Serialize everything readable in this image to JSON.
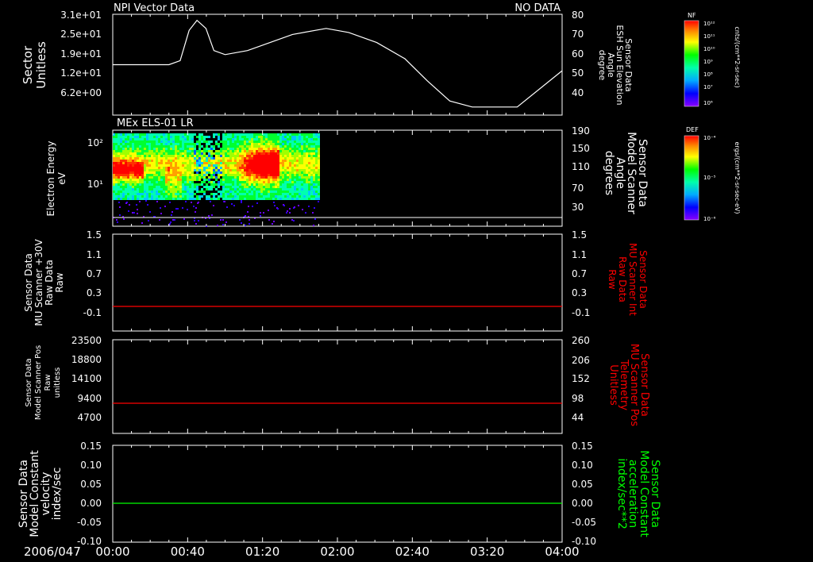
{
  "panel1": {
    "title": "NPI Vector Data",
    "status": "NO DATA",
    "left_label": [
      "Sector",
      "Unitless"
    ],
    "right_label": [
      "Sensor Data",
      "ESH Sun Elevation",
      "Angle",
      "degree"
    ],
    "left_ticks": [
      "3.1e+01",
      "2.5e+01",
      "1.9e+01",
      "1.2e+01",
      "6.2e+00"
    ],
    "right_ticks": [
      "80",
      "70",
      "60",
      "50",
      "40"
    ]
  },
  "panel2": {
    "title": "MEx ELS-01 LR",
    "left_label": [
      "Electron Energy",
      "eV"
    ],
    "right_label": [
      "Sensor Data",
      "Model Scanner",
      "Angle",
      "degrees"
    ],
    "left_ticks": [
      "10²",
      "10¹"
    ],
    "right_ticks": [
      "190",
      "150",
      "110",
      "70",
      "30"
    ]
  },
  "panel3": {
    "left_label": [
      "Sensor Data",
      "MU Scanner +30V",
      "Raw Data",
      "Raw"
    ],
    "right_label": [
      "Sensor Data",
      "MU Scanner Int",
      "Raw Data",
      "Raw"
    ],
    "left_ticks": [
      "1.5",
      "1.1",
      "0.7",
      "0.3",
      "-0.1"
    ],
    "right_ticks": [
      "1.5",
      "1.1",
      "0.7",
      "0.3",
      "-0.1"
    ]
  },
  "panel4": {
    "left_label": [
      "Sensor Data",
      "Model Scanner Pos",
      "Raw",
      "unitless"
    ],
    "right_label": [
      "Sensor Data",
      "MU Scanner Pos",
      "Telemetry",
      "Unitless"
    ],
    "left_ticks": [
      "23500",
      "18800",
      "14100",
      "9400",
      "4700"
    ],
    "right_ticks": [
      "260",
      "206",
      "152",
      "98",
      "44"
    ]
  },
  "panel5": {
    "left_label": [
      "Sensor Data",
      "Model Constant",
      "velocity",
      "index/sec"
    ],
    "right_label": [
      "Sensor Data",
      "Model Constant",
      "acceleration",
      "index/sec**2"
    ],
    "left_ticks": [
      "0.15",
      "0.10",
      "0.05",
      "0.00",
      "-0.05",
      "-0.10"
    ],
    "right_ticks": [
      "0.15",
      "0.10",
      "0.05",
      "0.00",
      "-0.05",
      "-0.10"
    ]
  },
  "time_axis": {
    "date": "2006/047",
    "ticks": [
      "00:00",
      "00:40",
      "01:20",
      "02:00",
      "02:40",
      "03:20",
      "04:00"
    ]
  },
  "colorbar1": {
    "title": "NF",
    "units": "cnts/(cm**2-sr-sec)",
    "ticks": [
      "10¹²",
      "10¹¹",
      "10¹⁰",
      "10⁹",
      "10⁸",
      "10⁷",
      "10⁶"
    ]
  },
  "colorbar2": {
    "title": "DEF",
    "units": "ergs/(cm**2-sr-sec-eV)",
    "ticks": [
      "10⁻⁴",
      "10⁻⁵",
      "10⁻⁶"
    ]
  },
  "colors": {
    "trace_white": "#ffffff",
    "trace_red": "#ff0000",
    "trace_green": "#00ff00",
    "label_red": "#ff0000",
    "label_green": "#00ff00"
  },
  "chart_data": [
    {
      "type": "line",
      "panel": "panel1",
      "x_unit": "hours since 00:00",
      "x": [
        0,
        0.5,
        0.6,
        0.68,
        0.75,
        0.83,
        0.9,
        1.0,
        1.2,
        1.4,
        1.6,
        1.9,
        2.1,
        2.35,
        2.6,
        2.8,
        3.0,
        3.2,
        3.4,
        3.6,
        4.0
      ],
      "y_unit": "degree",
      "y": [
        55,
        55,
        57,
        72,
        77,
        73,
        62,
        60,
        62,
        66,
        70,
        73,
        71,
        66,
        58,
        47,
        37,
        34,
        34,
        34,
        52
      ],
      "ylim": [
        30,
        80
      ]
    },
    {
      "type": "heatmap",
      "panel": "panel2",
      "x_range_hours": [
        0,
        1.8
      ],
      "y_label": "Electron Energy eV",
      "description_features": "intense flux at ~10-100 eV early and near 01:05-01:20"
    },
    {
      "type": "line",
      "panel": "panel3",
      "series": [
        {
          "values_constant": -0.05
        }
      ],
      "ylim": [
        -0.3,
        1.5
      ]
    },
    {
      "type": "line",
      "panel": "panel4",
      "series": [
        {
          "values_constant": 7500
        }
      ],
      "ylim": [
        0,
        23500
      ]
    },
    {
      "type": "line",
      "panel": "panel5",
      "series": [
        {
          "values_constant": 0.0
        }
      ],
      "ylim": [
        -0.1,
        0.15
      ]
    }
  ]
}
